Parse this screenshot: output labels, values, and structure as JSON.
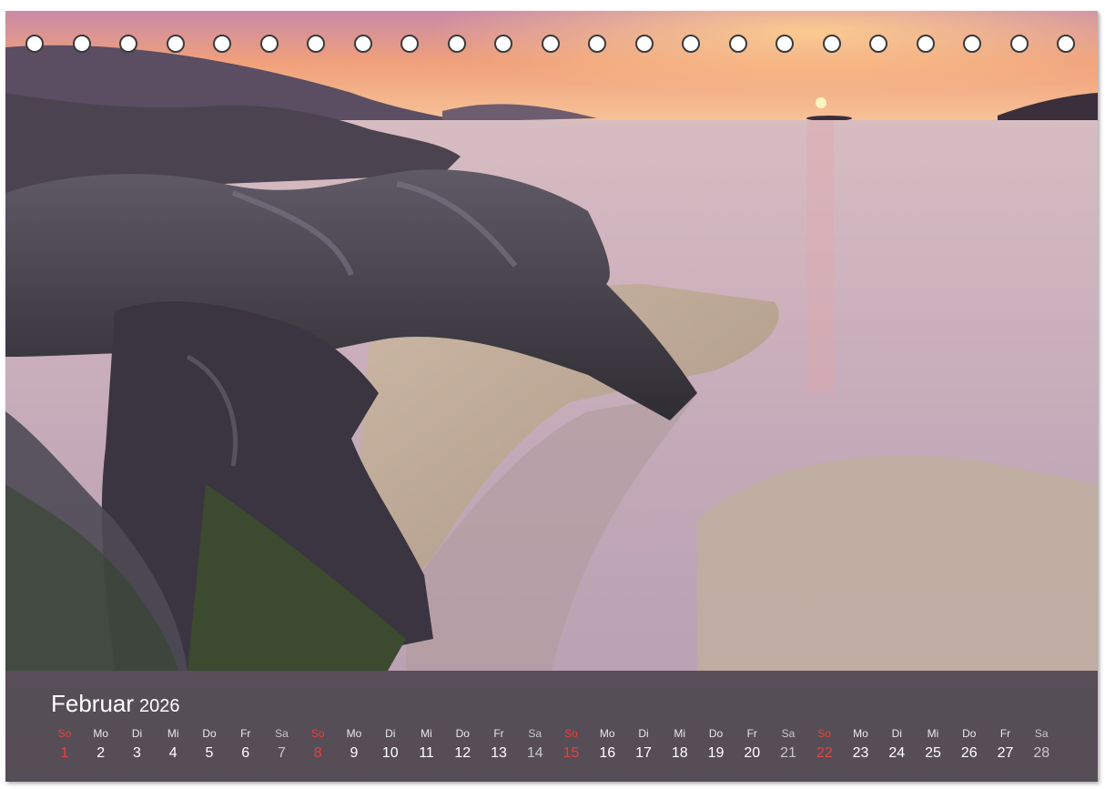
{
  "calendar": {
    "month": "Februar",
    "year": "2026",
    "days": [
      {
        "name": "So",
        "date": "1",
        "type": "sun"
      },
      {
        "name": "Mo",
        "date": "2",
        "type": "weekday"
      },
      {
        "name": "Di",
        "date": "3",
        "type": "weekday"
      },
      {
        "name": "Mi",
        "date": "4",
        "type": "weekday"
      },
      {
        "name": "Do",
        "date": "5",
        "type": "weekday"
      },
      {
        "name": "Fr",
        "date": "6",
        "type": "weekday"
      },
      {
        "name": "Sa",
        "date": "7",
        "type": "sat"
      },
      {
        "name": "So",
        "date": "8",
        "type": "sun"
      },
      {
        "name": "Mo",
        "date": "9",
        "type": "weekday"
      },
      {
        "name": "Di",
        "date": "10",
        "type": "weekday"
      },
      {
        "name": "Mi",
        "date": "11",
        "type": "weekday"
      },
      {
        "name": "Do",
        "date": "12",
        "type": "weekday"
      },
      {
        "name": "Fr",
        "date": "13",
        "type": "weekday"
      },
      {
        "name": "Sa",
        "date": "14",
        "type": "sat"
      },
      {
        "name": "So",
        "date": "15",
        "type": "sun"
      },
      {
        "name": "Mo",
        "date": "16",
        "type": "weekday"
      },
      {
        "name": "Di",
        "date": "17",
        "type": "weekday"
      },
      {
        "name": "Mi",
        "date": "18",
        "type": "weekday"
      },
      {
        "name": "Do",
        "date": "19",
        "type": "weekday"
      },
      {
        "name": "Fr",
        "date": "20",
        "type": "weekday"
      },
      {
        "name": "Sa",
        "date": "21",
        "type": "sat"
      },
      {
        "name": "So",
        "date": "22",
        "type": "sun"
      },
      {
        "name": "Mo",
        "date": "23",
        "type": "weekday"
      },
      {
        "name": "Di",
        "date": "24",
        "type": "weekday"
      },
      {
        "name": "Mi",
        "date": "25",
        "type": "weekday"
      },
      {
        "name": "Do",
        "date": "26",
        "type": "weekday"
      },
      {
        "name": "Fr",
        "date": "27",
        "type": "weekday"
      },
      {
        "name": "Sa",
        "date": "28",
        "type": "sat"
      }
    ]
  },
  "binding_holes": 23,
  "colors": {
    "sunday": "#e8413c",
    "saturday": "#c8c8c8",
    "weekday": "#ffffff",
    "band": "#28262c"
  }
}
